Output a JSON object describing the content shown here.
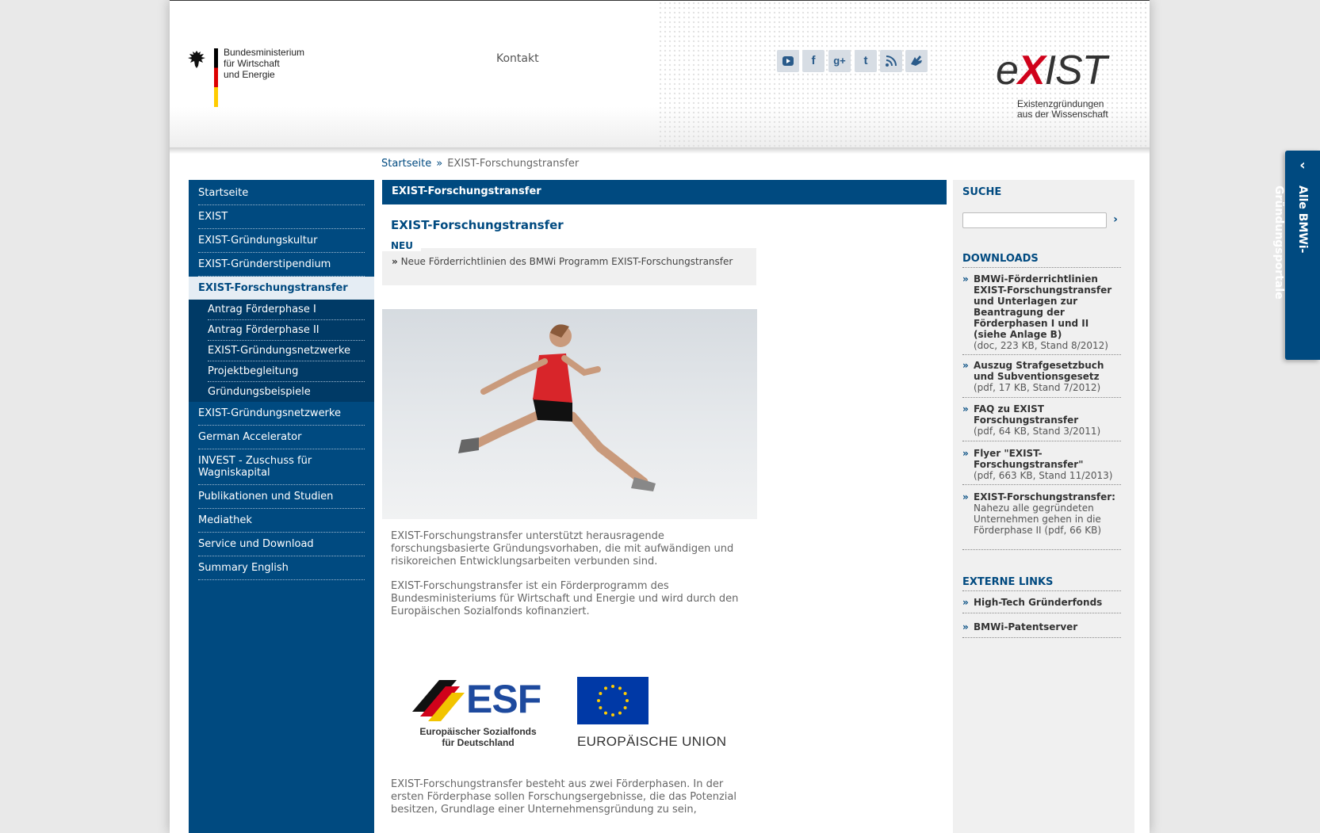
{
  "header": {
    "ministry_lines": [
      "Bundesministerium",
      "für Wirtschaft",
      "und Energie"
    ],
    "kontakt": "Kontakt",
    "social_icons": [
      {
        "name": "youtube-icon",
        "glyph": "▶"
      },
      {
        "name": "facebook-icon",
        "glyph": "f"
      },
      {
        "name": "googleplus-icon",
        "glyph": "g+"
      },
      {
        "name": "twitter-icon",
        "glyph": "t"
      },
      {
        "name": "rss-icon",
        "glyph": "◣"
      },
      {
        "name": "sign-language-icon",
        "glyph": "✋"
      }
    ],
    "exist_logo": {
      "pre": "e",
      "x": "X",
      "post": "IST",
      "sub1": "Existenzgründungen",
      "sub2": "aus der Wissenschaft"
    }
  },
  "breadcrumb": {
    "home": "Startseite",
    "sep": "»",
    "current": "EXIST-Forschungstransfer"
  },
  "nav": {
    "items": [
      "Startseite",
      "EXIST",
      "EXIST-Gründungskultur",
      "EXIST-Gründerstipendium"
    ],
    "active": "EXIST-Forschungstransfer",
    "sub_items": [
      "Antrag Förderphase I",
      "Antrag Förderphase II",
      "EXIST-Gründungsnetzwerke",
      "Projektbegleitung",
      "Gründungsbeispiele"
    ],
    "items_after": [
      "EXIST-Gründungsnetzwerke",
      "German Accelerator",
      "INVEST - Zuschuss für Wagniskapital",
      "Publikationen und Studien",
      "Mediathek",
      "Service und Download",
      "Summary English"
    ]
  },
  "main": {
    "bar_title": "EXIST-Forschungstransfer",
    "title": "EXIST-Forschungstransfer",
    "neu_label": "NEU",
    "neu_raquo": "»",
    "neu_link": "Neue Förderrichtlinien des BMWi Programm EXIST-Forschungstransfer",
    "para1": "EXIST-Forschungstransfer unterstützt herausragende forschungsbasierte Gründungsvorhaben, die mit aufwändigen und risikoreichen Entwicklungsarbeiten verbunden sind.",
    "para2": "EXIST-Forschungstransfer ist ein Förderprogramm des Bundesministeriums für Wirtschaft und Energie und wird durch den Europäischen Sozialfonds kofinanziert.",
    "para3": "EXIST-Forschungstransfer besteht aus zwei Förderphasen. In der ersten Förderphase sollen Forschungsergebnisse, die das Potenzial besitzen, Grundlage einer Unternehmensgründung zu sein,",
    "esf_word": "ESF",
    "esf_cap1": "Europäischer Sozialfonds",
    "esf_cap2": "für Deutschland",
    "eu_text": "EUROPÄISCHE UNION"
  },
  "right": {
    "search_heading": "SUCHE",
    "search_value": "",
    "search_go": "›",
    "downloads_heading": "DOWNLOADS",
    "downloads": [
      {
        "bold": "BMWi-Förderrichtlinien EXIST-Forschungstransfer und Unterlagen zur Beantragung der Förderphasen I und II (siehe Anlage B)",
        "meta": "(doc, 223 KB, Stand 8/2012)"
      },
      {
        "bold": "Auszug Strafgesetzbuch und Subventionsgesetz",
        "meta": "(pdf, 17 KB, Stand 7/2012)"
      },
      {
        "bold": "FAQ zu EXIST Forschungstransfer",
        "meta": "(pdf, 64 KB, Stand 3/2011)"
      },
      {
        "bold": "Flyer \"EXIST-Forschungstransfer\"",
        "meta": "(pdf, 663 KB, Stand 11/2013)"
      },
      {
        "bold": "EXIST-Forschungstransfer:",
        "meta": "Nahezu alle gegründeten Unternehmen gehen in die Förderphase II (pdf, 66 KB)"
      }
    ],
    "external_heading": "EXTERNE LINKS",
    "external_links": [
      "High-Tech Gründerfonds",
      "BMWi-Patentserver"
    ],
    "raquo": "»"
  },
  "sidetab": {
    "label": "Alle BMWi-Gründungsportale",
    "chevron": "‹"
  },
  "colors": {
    "primary_blue": "#004a80",
    "active_bg": "#e5edf4",
    "logo_red": "#d0021b"
  }
}
